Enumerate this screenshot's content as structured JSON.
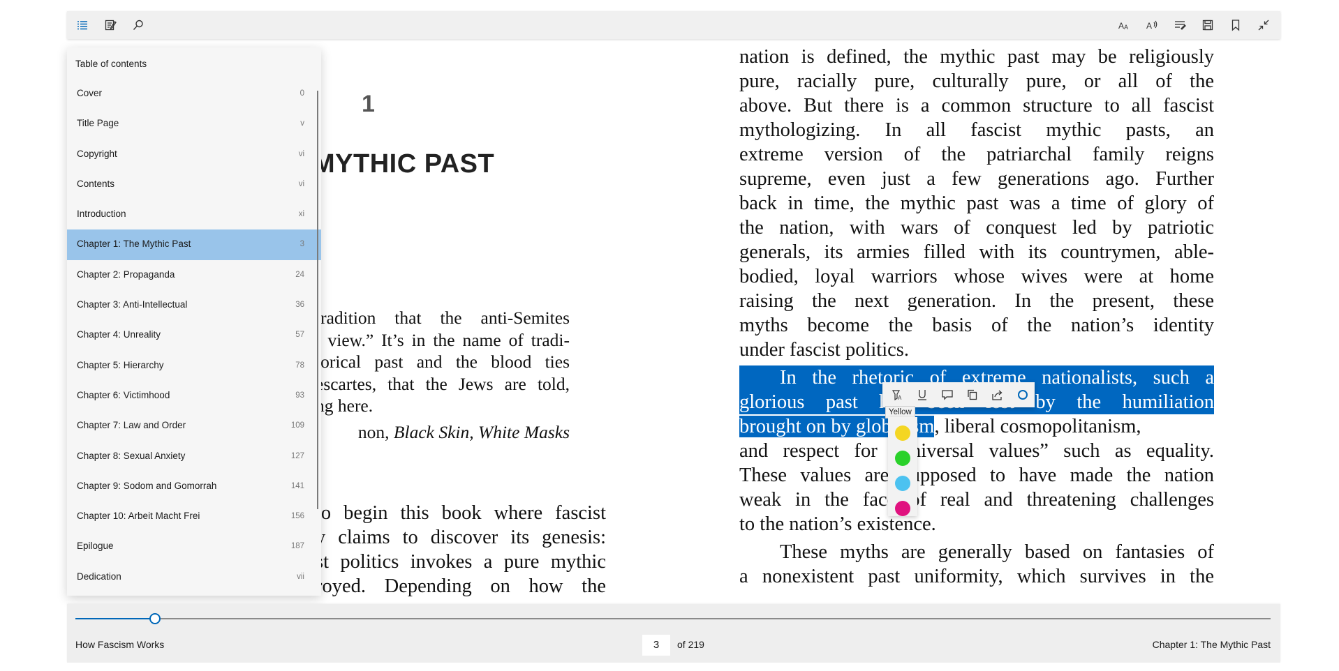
{
  "toolbar": {
    "left_icons": [
      "contents-icon",
      "notes-icon",
      "search-icon"
    ],
    "right_icons": [
      "text-options-icon",
      "read-aloud-icon",
      "learning-tools-icon",
      "save-icon",
      "bookmark-icon",
      "exit-fullscreen-icon"
    ]
  },
  "toc": {
    "header": "Table of contents",
    "items": [
      {
        "label": "Cover",
        "page": "0"
      },
      {
        "label": "Title Page",
        "page": "v"
      },
      {
        "label": "Copyright",
        "page": "vi"
      },
      {
        "label": "Contents",
        "page": "vi"
      },
      {
        "label": "Introduction",
        "page": "xi"
      },
      {
        "label": "Chapter 1: The Mythic Past",
        "page": "3"
      },
      {
        "label": "Chapter 2: Propaganda",
        "page": "24"
      },
      {
        "label": "Chapter 3: Anti-Intellectual",
        "page": "36"
      },
      {
        "label": "Chapter 4: Unreality",
        "page": "57"
      },
      {
        "label": "Chapter 5: Hierarchy",
        "page": "78"
      },
      {
        "label": "Chapter 6: Victimhood",
        "page": "93"
      },
      {
        "label": "Chapter 7: Law and Order",
        "page": "109"
      },
      {
        "label": "Chapter 8: Sexual Anxiety",
        "page": "127"
      },
      {
        "label": "Chapter 9: Sodom and Gomorrah",
        "page": "141"
      },
      {
        "label": "Chapter 10: Arbeit Macht Frei",
        "page": "156"
      },
      {
        "label": "Epilogue",
        "page": "187"
      },
      {
        "label": "Dedication",
        "page": "vii"
      }
    ],
    "active_index": 5
  },
  "left_page": {
    "chapter_number": "1",
    "chapter_title_visible": "MYTHIC PAST",
    "epigraph_lines": [
      "tradition that the anti-Semites",
      "’ view.” It’s in the name of tradi-",
      "torical past and the blood ties",
      "escartes, that the Jews are told,",
      "ng here."
    ],
    "epigraph_source_prefix": "non, ",
    "epigraph_source_title": "Black Skin, White Masks",
    "body_lines": [
      "to begin this book where fascist",
      "y claims to discover its genesis:",
      "st politics invokes a pure mythic",
      "royed. Depending on how the"
    ]
  },
  "right_page": {
    "para1_lines": [
      "nation is defined, the mythic past may be religiously",
      "pure, racially pure, culturally pure, or all of the",
      "above. But there is a common structure to all fascist",
      "mythologizing. In all fascist mythic pasts, an",
      "extreme version of the patriarchal family reigns",
      "supreme, even just a few generations ago. Further",
      "back in time, the mythic past was a time of glory of",
      "the nation, with wars of conquest led by patriotic",
      "generals, its armies filled with its countrymen, able-",
      "bodied, loyal warriors whose wives were at home",
      "raising the next generation. In the present, these",
      "myths become the basis of the nation’s identity",
      "under fascist politics."
    ],
    "para2": {
      "sel_line1": "In the rhetoric of extreme nationalists, such a",
      "sel_line2": "glorious past has been lost by the humiliation",
      "sel_line3": "brought on by globalism",
      "line3_rest": ", liberal cosmopolitanism,",
      "lines": [
        "and respect for “universal values” such as equality.",
        "These values are supposed to have made the nation",
        "weak in the face of real and threatening challenges",
        "to the nation’s existence."
      ]
    },
    "para3_lines": [
      "These myths are generally based on fantasies of",
      "a nonexistent past uniformity, which survives in the"
    ]
  },
  "highlight_menu": {
    "icons": [
      "highlight-icon",
      "underline-icon",
      "comment-icon",
      "copy-icon",
      "share-icon",
      "color-circle-icon"
    ],
    "tooltip": "Yellow",
    "colors": [
      {
        "name": "yellow",
        "hex": "#f4d623"
      },
      {
        "name": "green",
        "hex": "#2ad12a"
      },
      {
        "name": "blue",
        "hex": "#4cc2f0"
      },
      {
        "name": "pink",
        "hex": "#e0127f"
      }
    ]
  },
  "footer": {
    "book_title": "How Fascism Works",
    "current_page": "3",
    "of_total": "of 219",
    "chapter": "Chapter 1: The Mythic Past",
    "progress": 0.066
  },
  "colors": {
    "accent": "#0067c0",
    "toc_active": "#99c4ea"
  }
}
